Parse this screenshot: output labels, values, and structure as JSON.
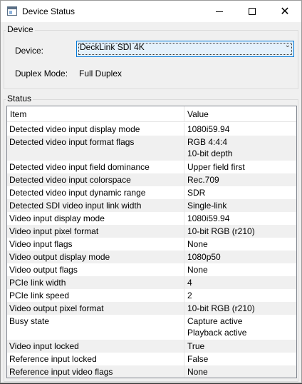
{
  "window": {
    "title": "Device Status"
  },
  "device_group": {
    "label": "Device",
    "device_label": "Device:",
    "device_value": "DeckLink SDI 4K",
    "duplex_label": "Duplex Mode:",
    "duplex_value": "Full Duplex"
  },
  "status_group": {
    "label": "Status",
    "columns": [
      "Item",
      "Value"
    ],
    "rows": [
      {
        "item": "Detected video input display mode",
        "value": [
          "1080i59.94"
        ]
      },
      {
        "item": "Detected video input format flags",
        "value": [
          "RGB 4:4:4",
          "10-bit depth"
        ]
      },
      {
        "item": "Detected video input field dominance",
        "value": [
          "Upper field first"
        ]
      },
      {
        "item": "Detected video input colorspace",
        "value": [
          "Rec.709"
        ]
      },
      {
        "item": "Detected video input dynamic range",
        "value": [
          "SDR"
        ]
      },
      {
        "item": "Detected SDI video input link width",
        "value": [
          "Single-link"
        ]
      },
      {
        "item": "Video input display mode",
        "value": [
          "1080i59.94"
        ]
      },
      {
        "item": "Video input pixel format",
        "value": [
          "10-bit RGB (r210)"
        ]
      },
      {
        "item": "Video input flags",
        "value": [
          "None"
        ]
      },
      {
        "item": "Video output display mode",
        "value": [
          "1080p50"
        ]
      },
      {
        "item": "Video output flags",
        "value": [
          "None"
        ]
      },
      {
        "item": "PCIe link width",
        "value": [
          "4"
        ]
      },
      {
        "item": "PCIe link speed",
        "value": [
          "2"
        ]
      },
      {
        "item": "Video output pixel format",
        "value": [
          "10-bit RGB (r210)"
        ]
      },
      {
        "item": "Busy state",
        "value": [
          "Capture active",
          "Playback active"
        ]
      },
      {
        "item": "Video input locked",
        "value": [
          "True"
        ]
      },
      {
        "item": "Reference input locked",
        "value": [
          "False"
        ]
      },
      {
        "item": "Reference input video flags",
        "value": [
          "None"
        ]
      }
    ]
  },
  "icons": {
    "app": "window-app-icon",
    "minimize": "minimize-icon",
    "maximize": "maximize-icon",
    "close": "close-icon",
    "dropdown": "chevron-down-icon"
  },
  "colors": {
    "combo_border": "#0078d7",
    "combo_fill": "#e5f1fb",
    "alt_row": "#f0f0f0"
  }
}
